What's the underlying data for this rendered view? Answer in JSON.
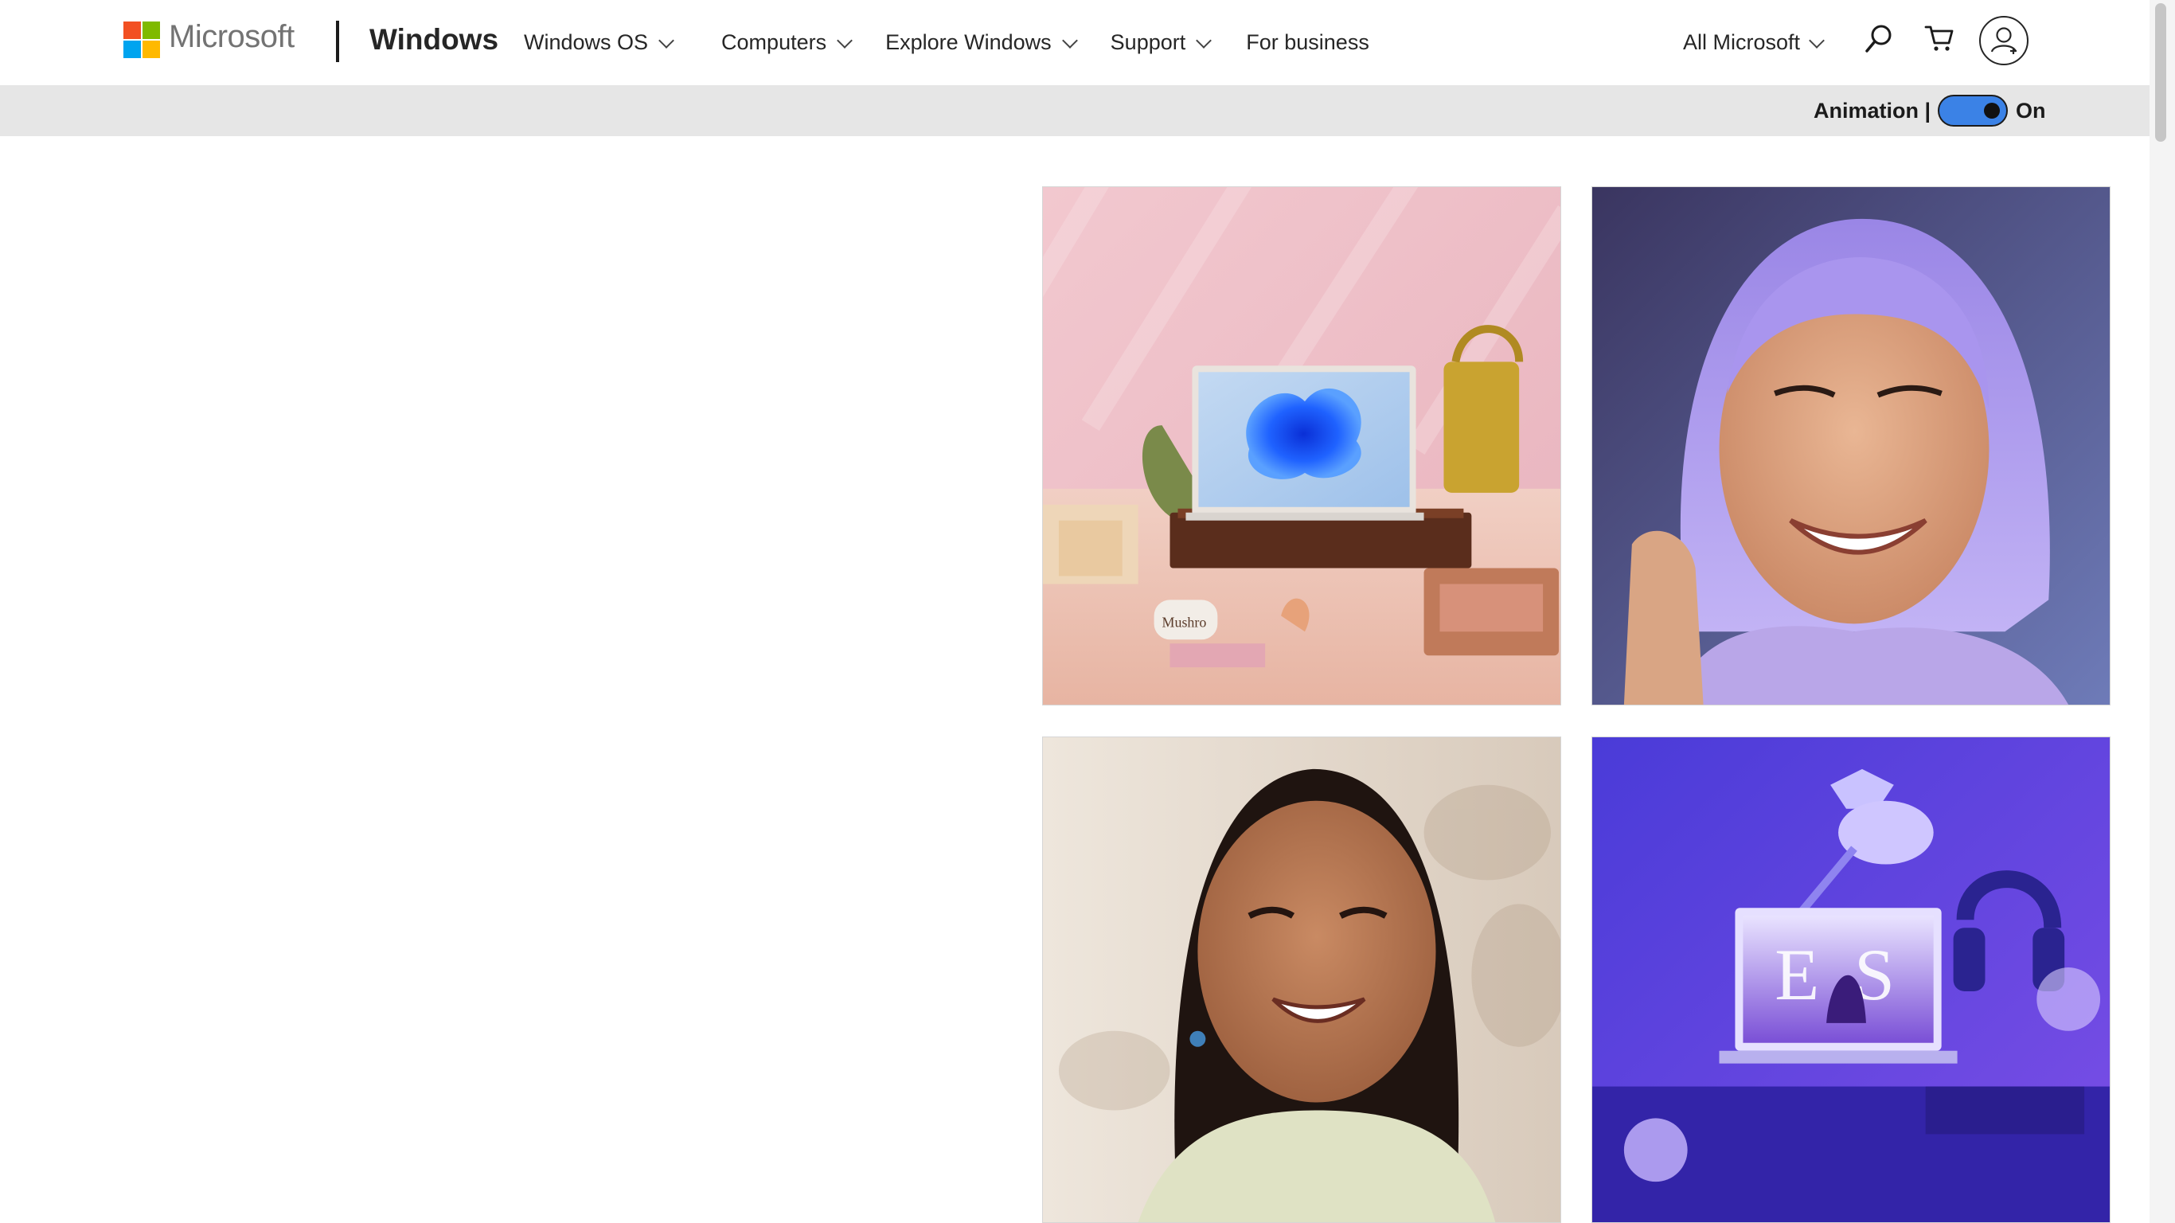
{
  "header": {
    "company": "Microsoft",
    "brand": "Windows",
    "nav": [
      {
        "label": "Windows OS",
        "has_menu": true
      },
      {
        "label": "Computers",
        "has_menu": true
      },
      {
        "label": "Explore Windows",
        "has_menu": true
      },
      {
        "label": "Support",
        "has_menu": true
      },
      {
        "label": "For business",
        "has_menu": false
      }
    ],
    "all_microsoft": "All Microsoft",
    "icons": [
      "search-icon",
      "cart-icon",
      "account-icon"
    ]
  },
  "animation_bar": {
    "label": "Animation |",
    "state": "On",
    "enabled": true
  },
  "gallery": {
    "tiles": [
      {
        "subject": "laptop with Windows bloom wallpaper on a pink tabletop",
        "label": "Mushro"
      },
      {
        "subject": "smiling woman with lavender hair"
      },
      {
        "subject": "smiling man with long dark hair"
      },
      {
        "subject": "laptop and desk lamp on a purple desk"
      }
    ]
  },
  "colors": {
    "ms_red": "#f25022",
    "ms_green": "#7fba00",
    "ms_blue": "#00a4ef",
    "ms_yellow": "#ffb900",
    "toggle_on": "#3b82e6",
    "anim_bar_bg": "#e6e6e6"
  }
}
